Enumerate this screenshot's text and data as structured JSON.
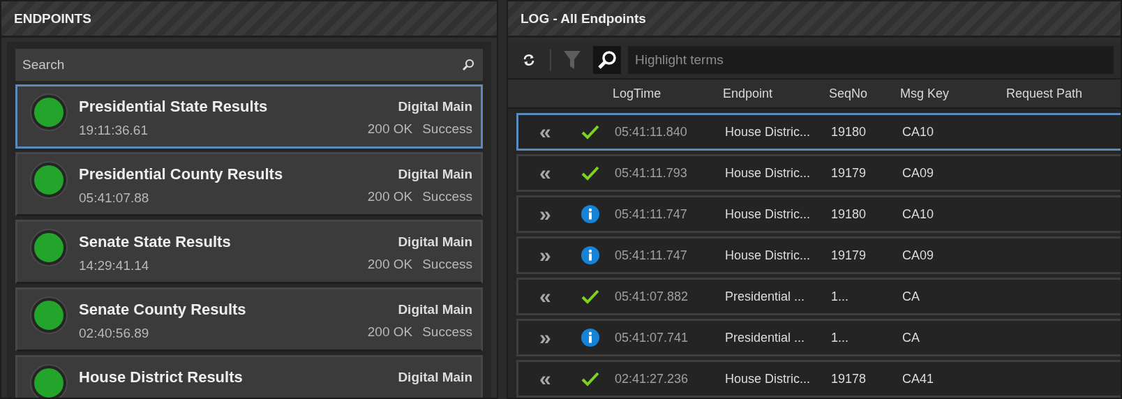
{
  "endpoints_panel": {
    "title": "ENDPOINTS",
    "search": {
      "placeholder": "Search"
    },
    "items": [
      {
        "name": "Presidential State Results",
        "time": "19:11:36.61",
        "channel": "Digital Main",
        "status": "200 OK",
        "result": "Success",
        "selected": true
      },
      {
        "name": "Presidential County Results",
        "time": "05:41:07.88",
        "channel": "Digital Main",
        "status": "200 OK",
        "result": "Success",
        "selected": false
      },
      {
        "name": "Senate State Results",
        "time": "14:29:41.14",
        "channel": "Digital Main",
        "status": "200 OK",
        "result": "Success",
        "selected": false
      },
      {
        "name": "Senate County Results",
        "time": "02:40:56.89",
        "channel": "Digital Main",
        "status": "200 OK",
        "result": "Success",
        "selected": false
      },
      {
        "name": "House District Results",
        "channel": "Digital Main",
        "selected": false
      }
    ]
  },
  "log_panel": {
    "title": "LOG - All Endpoints",
    "search": {
      "placeholder": "Highlight terms"
    },
    "columns": [
      "LogTime",
      "Endpoint",
      "SeqNo",
      "Msg Key",
      "Request Path"
    ],
    "rows": [
      {
        "arrow": "«",
        "kind": "success",
        "time": "05:41:11.840",
        "endpoint": "House Distric...",
        "seq": "19180",
        "key": "CA10",
        "selected": true
      },
      {
        "arrow": "«",
        "kind": "success",
        "time": "05:41:11.793",
        "endpoint": "House Distric...",
        "seq": "19179",
        "key": "CA09",
        "selected": false
      },
      {
        "arrow": "»",
        "kind": "info",
        "time": "05:41:11.747",
        "endpoint": "House Distric...",
        "seq": "19180",
        "key": "CA10",
        "selected": false
      },
      {
        "arrow": "»",
        "kind": "info",
        "time": "05:41:11.747",
        "endpoint": "House Distric...",
        "seq": "19179",
        "key": "CA09",
        "selected": false
      },
      {
        "arrow": "«",
        "kind": "success",
        "time": "05:41:07.882",
        "endpoint": "Presidential ...",
        "seq": "1...",
        "key": "CA",
        "selected": false
      },
      {
        "arrow": "»",
        "kind": "info",
        "time": "05:41:07.741",
        "endpoint": "Presidential ...",
        "seq": "1...",
        "key": "CA",
        "selected": false
      },
      {
        "arrow": "«",
        "kind": "success",
        "time": "02:41:27.236",
        "endpoint": "House Distric...",
        "seq": "19178",
        "key": "CA41",
        "selected": false
      }
    ]
  }
}
